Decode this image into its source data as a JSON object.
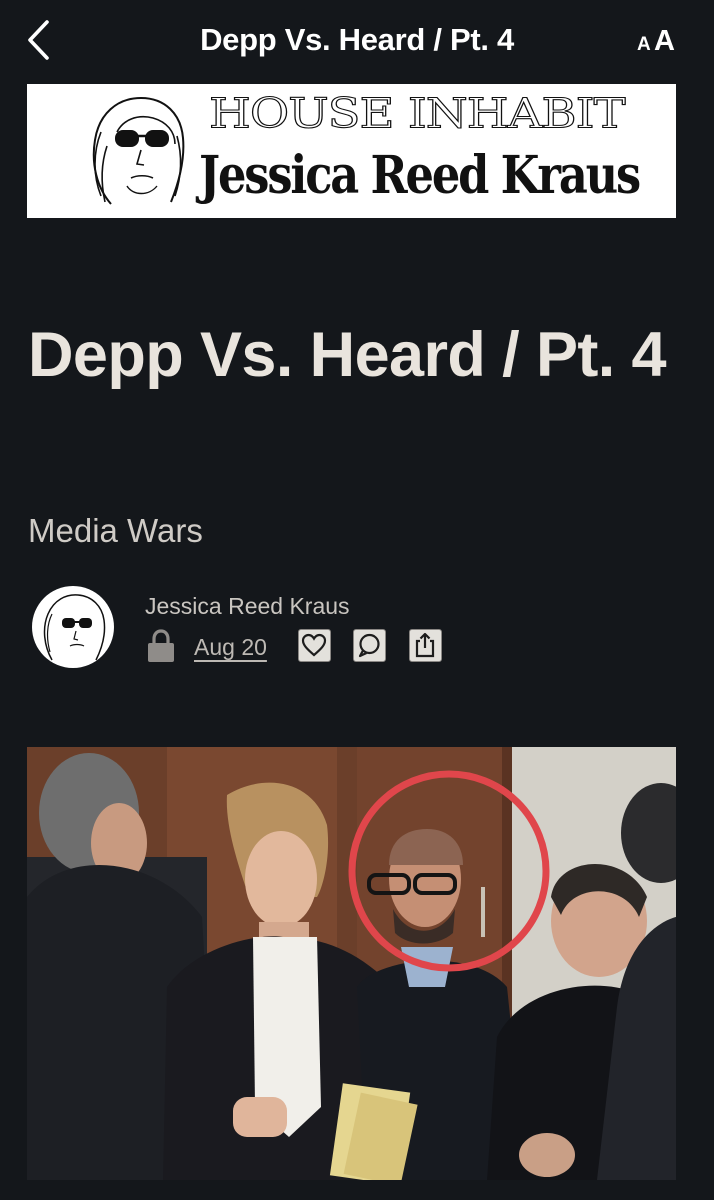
{
  "nav": {
    "title": "Depp Vs. Heard / Pt. 4",
    "back_icon": "chevron-left-icon",
    "text_size_icon": "text-size-icon",
    "text_size_label": "AA"
  },
  "banner": {
    "line1": "HOUSE INHABIT",
    "line2": "Jessica Reed Kraus",
    "logo_icon": "sunglasses-portrait-icon"
  },
  "article": {
    "title": "Depp Vs. Heard / Pt. 4",
    "subtitle": "Media Wars"
  },
  "byline": {
    "author": "Jessica Reed Kraus",
    "date": "Aug 20",
    "icons": [
      "lock-icon",
      "heart-icon",
      "comment-icon",
      "share-icon"
    ]
  },
  "photo": {
    "highlight_color": "#e0464b"
  },
  "colors": {
    "background": "#14171b",
    "title_text": "#e9e4dd",
    "banner_background": "#ffffff"
  }
}
